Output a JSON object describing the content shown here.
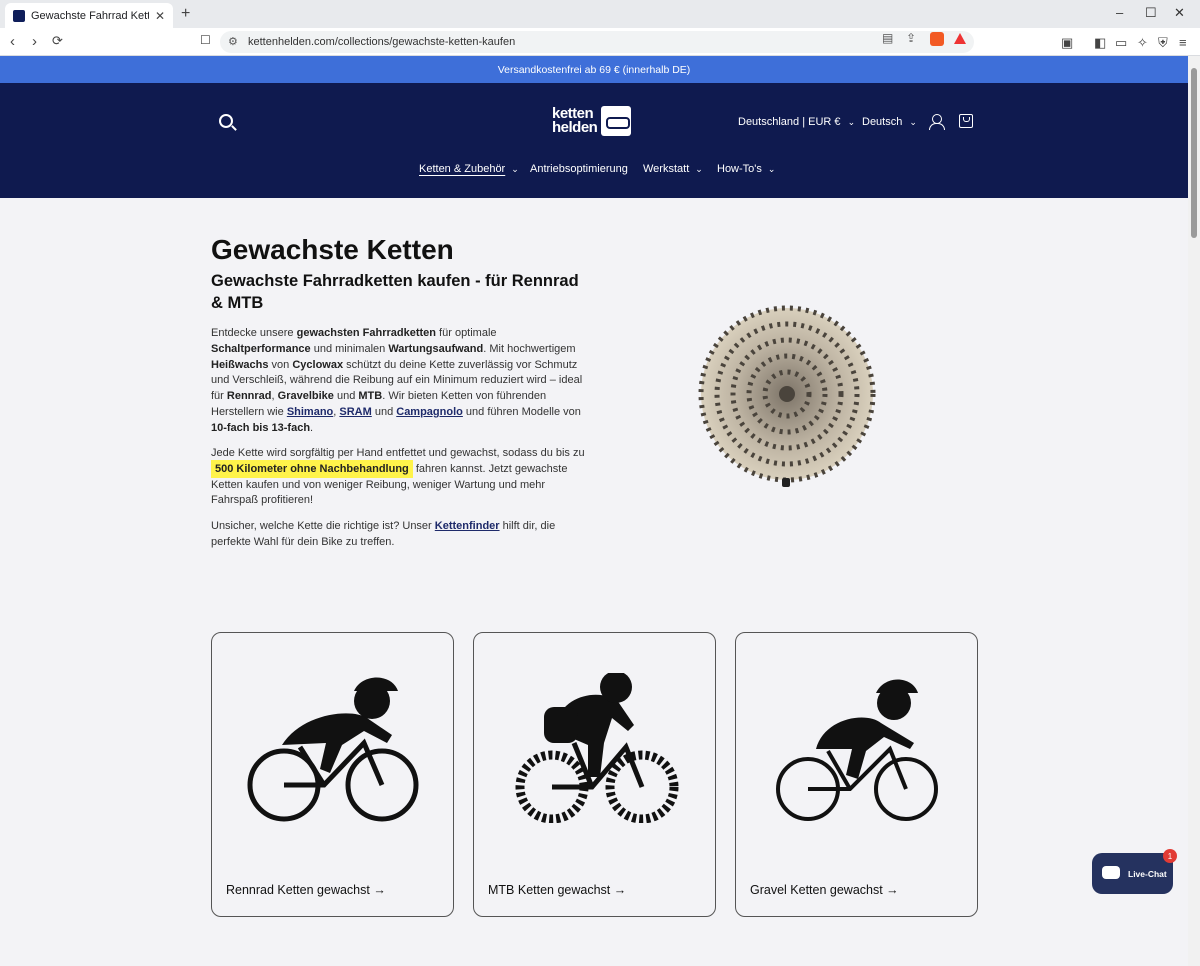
{
  "browser": {
    "tab_title": "Gewachste Fahrrad Ketten kaufen",
    "tab_close": "✕",
    "new_tab": "+",
    "url": "kettenhelden.com/collections/gewachste-ketten-kaufen",
    "window_controls": [
      "–",
      "☐",
      "✕"
    ]
  },
  "announcement": "Versandkostenfrei ab 69 € (innerhalb DE)",
  "header": {
    "logo_line1": "ketten",
    "logo_line2": "helden",
    "country": "Deutschland | EUR €",
    "language": "Deutsch",
    "nav": [
      {
        "label": "Ketten & Zubehör",
        "has_caret": true
      },
      {
        "label": "Antriebsoptimierung",
        "has_caret": false
      },
      {
        "label": "Werkstatt",
        "has_caret": true
      },
      {
        "label": "How-To's",
        "has_caret": true
      }
    ],
    "caret": "⌄"
  },
  "intro": {
    "title": "Gewachste Ketten",
    "subtitle": "Gewachste Fahrradketten kaufen - für Rennrad & MTB",
    "p1": {
      "t1": "Entdecke unsere ",
      "b1": "gewachsten Fahrradketten",
      "t2": " für optimale ",
      "b2": "Schaltperformance",
      "t3": " und minimalen ",
      "b3": "Wartungsaufwand",
      "t4": ". Mit hochwertigem ",
      "b4": "Heißwachs",
      "t5": " von ",
      "b5": "Cyclowax",
      "t6": " schützt du deine Kette zuverlässig vor Schmutz und Verschleiß, während die Reibung auf ein Minimum reduziert wird – ideal für ",
      "b6": "Rennrad",
      "t7": ", ",
      "b7": "Gravelbike",
      "t8": " und ",
      "b8": "MTB",
      "t9": ". Wir bieten Ketten von führenden Herstellern wie ",
      "a1": "Shimano",
      "t10": ", ",
      "a2": "SRAM",
      "t11": " und ",
      "a3": "Campagnolo",
      "t12": " und führen Modelle von ",
      "b9": "10-fach bis 13-fach",
      "t13": "."
    },
    "p2": {
      "t1": "Jede Kette wird sorgfältig per Hand entfettet und gewachst, sodass du bis zu ",
      "hl": "500 Kilometer ohne Nachbehandlung",
      "t2": " fahren kannst. Jetzt gewachste Ketten kaufen und von weniger Reibung, weniger Wartung und mehr Fahrspaß profitieren!"
    },
    "p3": {
      "t1": "Unsicher, welche Kette die richtige ist? Unser ",
      "a1": "Kettenfinder",
      "t2": " hilft dir, die perfekte Wahl für dein Bike zu treffen."
    }
  },
  "cards": [
    {
      "label": "Rennrad Ketten gewachst →",
      "icon": "road-cyclist-icon"
    },
    {
      "label": "MTB Ketten gewachst →",
      "icon": "mtb-cyclist-icon"
    },
    {
      "label": "Gravel Ketten gewachst →",
      "icon": "gravel-cyclist-icon"
    }
  ],
  "chat": {
    "label": "Live-Chat",
    "badge": "1"
  },
  "colors": {
    "announcement": "#3e6fd9",
    "header": "#0f1a4f",
    "highlight": "#fff34a",
    "page_bg": "#f3f3f6"
  }
}
